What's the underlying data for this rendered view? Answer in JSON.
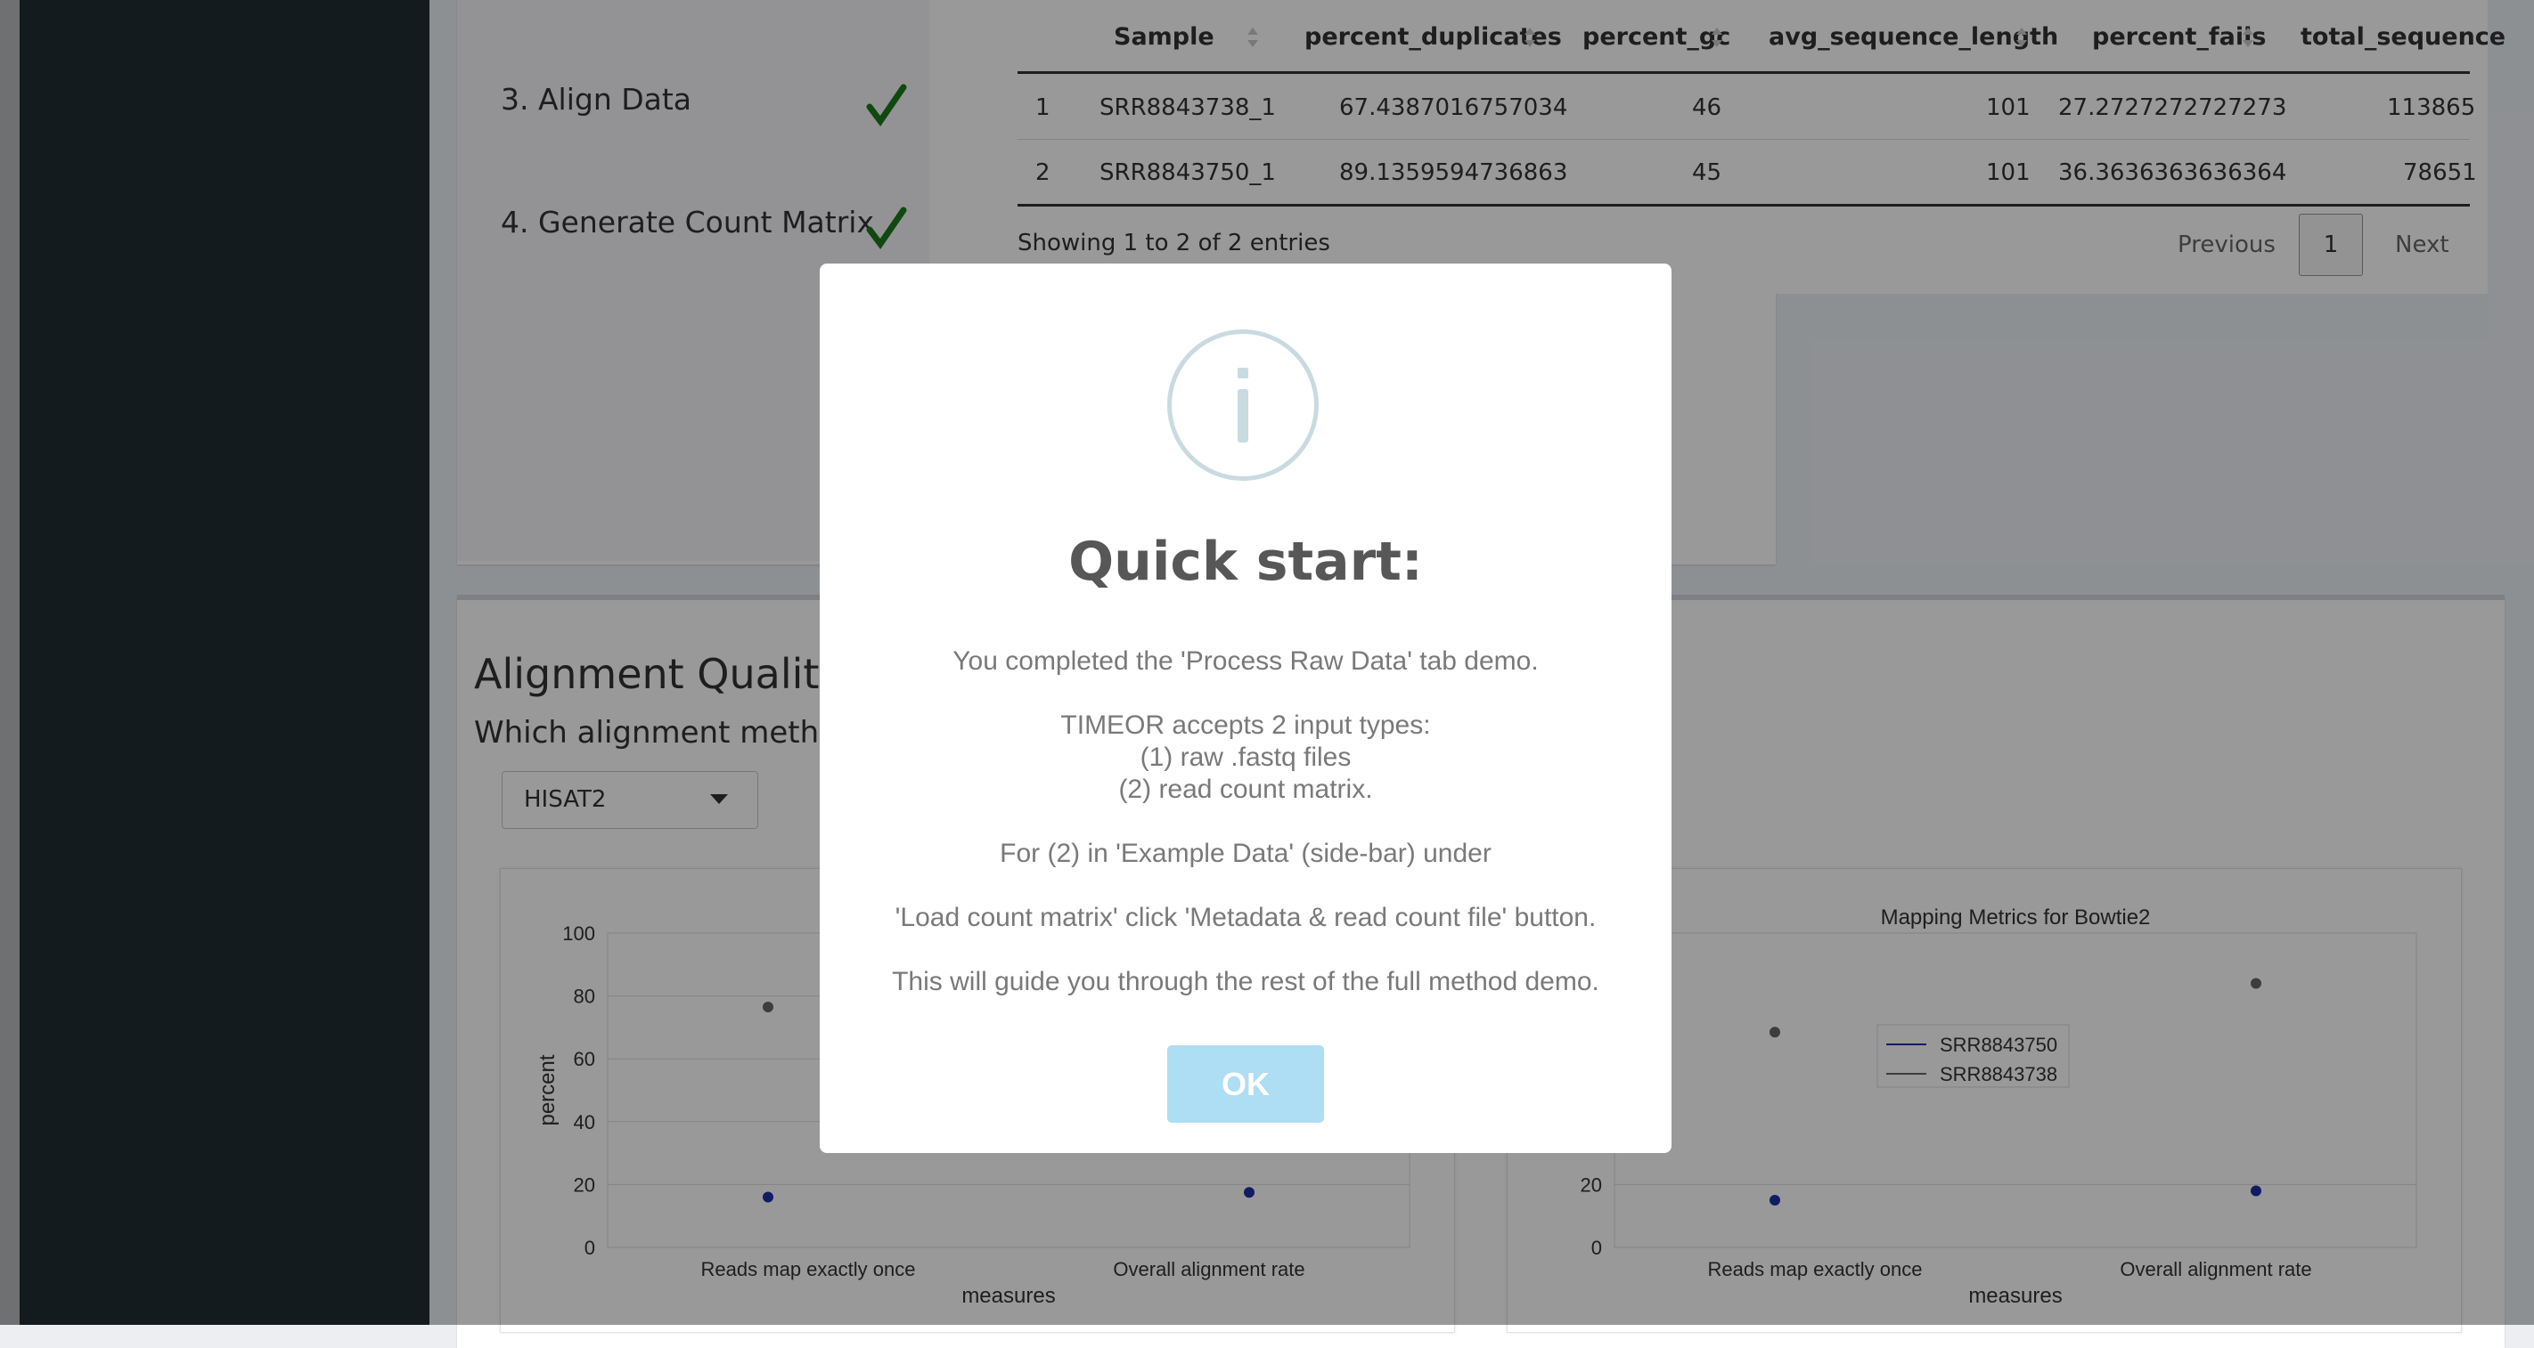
{
  "steps": [
    {
      "label": "3. Align Data",
      "done": true
    },
    {
      "label": "4. Generate Count Matrix",
      "done": true
    }
  ],
  "qc_table": {
    "columns": [
      "Sample",
      "percent_duplicates",
      "percent_gc",
      "avg_sequence_length",
      "percent_fails",
      "total_sequence"
    ],
    "rows": [
      {
        "index": "1",
        "sample": "SRR8843738_1",
        "percent_duplicates": "67.4387016757034",
        "percent_gc": "46",
        "avg_sequence_length": "101",
        "percent_fails": "27.2727272727273",
        "total_sequence": "113865"
      },
      {
        "index": "2",
        "sample": "SRR8843750_1",
        "percent_duplicates": "89.1359594736863",
        "percent_gc": "45",
        "avg_sequence_length": "101",
        "percent_fails": "36.3636363636364",
        "total_sequence": "78651"
      }
    ],
    "info": "Showing 1 to 2 of 2 entries",
    "pagination": {
      "previous": "Previous",
      "page": "1",
      "next": "Next"
    }
  },
  "alignment": {
    "title": "Alignment Quality",
    "question": "Which alignment method?",
    "method_select": "HISAT2"
  },
  "chart_data": [
    {
      "type": "scatter",
      "title": "",
      "xlabel": "measures",
      "ylabel": "percent",
      "categories": [
        "Reads map exactly once",
        "Overall alignment rate"
      ],
      "ylim": [
        0,
        100
      ],
      "yticks": [
        "0",
        "20",
        "40",
        "60",
        "80",
        "100"
      ],
      "series": [
        {
          "name": "SRR8843750",
          "color": "#1f2fa5",
          "values": [
            16,
            17.5
          ]
        },
        {
          "name": "SRR8843738",
          "color": "#666666",
          "values": [
            76.5,
            null
          ]
        }
      ]
    },
    {
      "type": "scatter",
      "title": "Mapping Metrics for Bowtie2",
      "xlabel": "measures",
      "ylabel": "",
      "categories": [
        "Reads map exactly once",
        "Overall alignment rate"
      ],
      "ylim": [
        0,
        100
      ],
      "yticks": [
        "0",
        "20"
      ],
      "legend": [
        "SRR8843750",
        "SRR8843738"
      ],
      "series": [
        {
          "name": "SRR8843750",
          "color": "#1f2fa5",
          "values": [
            15,
            18
          ]
        },
        {
          "name": "SRR8843738",
          "color": "#666666",
          "values": [
            68.5,
            84
          ]
        }
      ]
    }
  ],
  "modal": {
    "title": "Quick start:",
    "lines": [
      "You completed the 'Process Raw Data' tab demo.",
      "TIMEOR accepts 2 input types:",
      "(1) raw .fastq files",
      "(2) read count matrix.",
      "For (2) in 'Example Data' (side-bar) under",
      "'Load count matrix' click 'Metadata & read count file' button.",
      "This will guide you through the rest of the full method demo."
    ],
    "ok_label": "OK",
    "icon": "info-icon"
  },
  "colors": {
    "sidebar": "#222d32",
    "check": "#1a7a1a",
    "ok_button": "#aedef4",
    "series_blue": "#1f2fa5",
    "series_gray": "#666666"
  }
}
